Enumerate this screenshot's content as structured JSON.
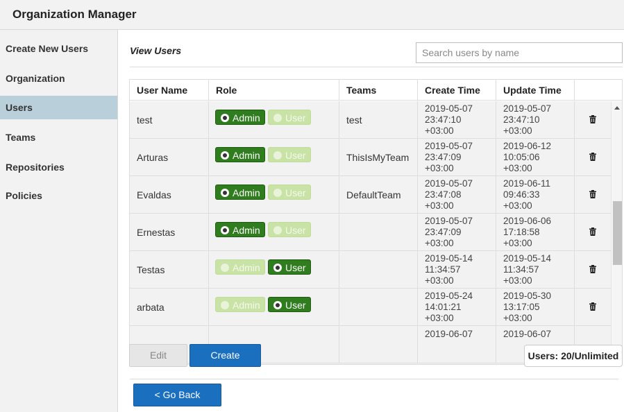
{
  "app": {
    "title": "Organization Manager"
  },
  "sidebar": {
    "items": [
      {
        "label": "Create New Users",
        "active": false
      },
      {
        "label": "Organization",
        "active": false
      },
      {
        "label": "Users",
        "active": true
      },
      {
        "label": "Teams",
        "active": false
      },
      {
        "label": "Repositories",
        "active": false
      },
      {
        "label": "Policies",
        "active": false
      }
    ]
  },
  "main": {
    "title": "View Users",
    "search": {
      "placeholder": "Search users by name",
      "value": ""
    }
  },
  "table": {
    "columns": [
      "User Name",
      "Role",
      "Teams",
      "Create Time",
      "Update Time"
    ],
    "role_labels": {
      "admin": "Admin",
      "user": "User"
    },
    "rows": [
      {
        "user": "test",
        "role": "Admin",
        "teams": "test",
        "created": [
          "2019-05-07",
          "23:47:10",
          "+03:00"
        ],
        "updated": [
          "2019-05-07",
          "23:47:10",
          "+03:00"
        ]
      },
      {
        "user": "Arturas",
        "role": "Admin",
        "teams": "ThisIsMyTeam",
        "created": [
          "2019-05-07",
          "23:47:09",
          "+03:00"
        ],
        "updated": [
          "2019-06-12",
          "10:05:06",
          "+03:00"
        ]
      },
      {
        "user": "Evaldas",
        "role": "Admin",
        "teams": "DefaultTeam",
        "created": [
          "2019-05-07",
          "23:47:08",
          "+03:00"
        ],
        "updated": [
          "2019-06-11",
          "09:46:33",
          "+03:00"
        ]
      },
      {
        "user": "Ernestas",
        "role": "Admin",
        "teams": "",
        "created": [
          "2019-05-07",
          "23:47:09",
          "+03:00"
        ],
        "updated": [
          "2019-06-06",
          "17:18:58",
          "+03:00"
        ]
      },
      {
        "user": "Testas",
        "role": "User",
        "teams": "",
        "created": [
          "2019-05-14",
          "11:34:57",
          "+03:00"
        ],
        "updated": [
          "2019-05-14",
          "11:34:57",
          "+03:00"
        ]
      },
      {
        "user": "arbata",
        "role": "User",
        "teams": "",
        "created": [
          "2019-05-24",
          "14:01:21",
          "+03:00"
        ],
        "updated": [
          "2019-05-30",
          "13:17:05",
          "+03:00"
        ]
      },
      {
        "user": "",
        "role": "",
        "teams": "",
        "created": [
          "2019-06-07",
          "",
          ""
        ],
        "updated": [
          "2019-06-07",
          "",
          ""
        ]
      }
    ]
  },
  "actions": {
    "edit_label": "Edit",
    "create_label": "Create",
    "users_count": "Users: 20/Unlimited",
    "back_label": "< Go Back"
  },
  "colors": {
    "accent_blue": "#1a6fbf",
    "admin_green": "#2f7d1e",
    "inactive_green": "#c9e3a6",
    "active_sidebar": "#b9cfd9"
  },
  "icons": {
    "row_action": "trash-icon"
  }
}
